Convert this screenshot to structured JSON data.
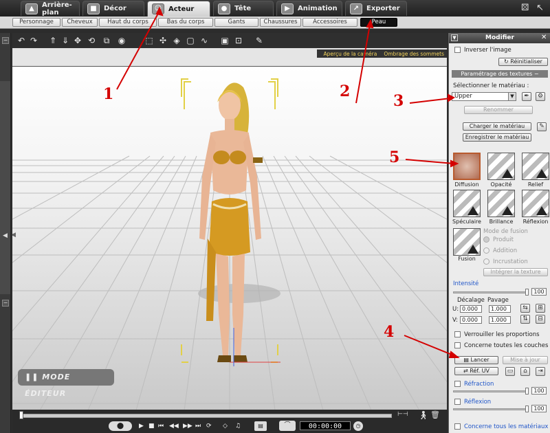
{
  "top_tabs": [
    {
      "label": "Arrière-plan",
      "icon": "landscape-icon"
    },
    {
      "label": "Décor",
      "icon": "box-icon"
    },
    {
      "label": "Acteur",
      "icon": "actor-icon"
    },
    {
      "label": "Tête",
      "icon": "head-icon"
    },
    {
      "label": "Animation",
      "icon": "film-icon"
    },
    {
      "label": "Exporter",
      "icon": "export-icon"
    }
  ],
  "sub_tabs": [
    "Personnage",
    "Cheveux",
    "Haut du corps",
    "Bas du corps",
    "Gants",
    "Chaussures",
    "Accessoires",
    "Peau"
  ],
  "viewport": {
    "camera_tab": "Aperçu de la caméra",
    "shading_tab": "Ombrage des sommets",
    "mode_label": "MODE ÉDITEUR"
  },
  "timeline": {
    "timecode": "00:00:00"
  },
  "panel": {
    "title": "Modifier",
    "invert_image": "Inverser l'image",
    "reset": "Réinitialiser",
    "texture_settings": "Paramétrage des textures",
    "select_material": "Sélectionner le matériau :",
    "material_value": "Upper",
    "rename": "Renommer",
    "load_material": "Charger le matériau",
    "save_material": "Enregistrer le matériau",
    "textures": [
      "Diffusion",
      "Opacité",
      "Relief",
      "Spéculaire",
      "Brillance",
      "Réflexion",
      "Fusion"
    ],
    "blend_mode": "Mode de fusion",
    "blend_options": [
      "Produit",
      "Addition",
      "Incrustation"
    ],
    "integrate_texture": "Intégrer la texture",
    "intensity": "Intensité",
    "intensity_value": "100",
    "offset": "Décalage",
    "tiling": "Pavage",
    "u_label": "U:",
    "v_label": "V:",
    "u_offset": "0.000",
    "u_tiling": "1.000",
    "v_offset": "0.000",
    "v_tiling": "1.000",
    "lock_proportions": "Verrouiller les proportions",
    "all_layers": "Concerne toutes les couches",
    "launch": "Lancer",
    "update": "Mise à jour",
    "uv_ref": "Réf. UV",
    "refraction": "Réfraction",
    "refraction_value": "100",
    "reflection": "Réflexion",
    "reflection_value": "100",
    "all_materials": "Concerne tous les matériaux"
  },
  "annotations": [
    "1",
    "2",
    "3",
    "4",
    "5"
  ],
  "colors": {
    "annotation": "#d40000",
    "accent_blue": "#1f55c8",
    "viewport_tab_text": "#f3d35c"
  }
}
